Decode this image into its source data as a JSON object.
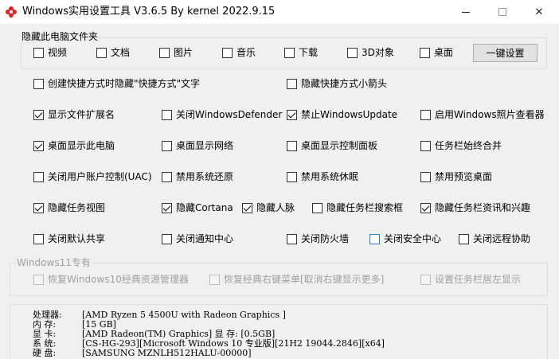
{
  "window": {
    "title": "Windows实用设置工具 V3.6.5 By kernel 2022.9.15",
    "icon": "flower-app-icon",
    "close_glyph": "✕"
  },
  "hide_folders": {
    "label": "隐藏此电脑文件夹",
    "items": [
      "视频",
      "文档",
      "图片",
      "音乐",
      "下载",
      "3D对象",
      "桌面"
    ],
    "button": "一键设置"
  },
  "options": {
    "create_shortcut": "创建快捷方式时隐藏\"快捷方式\"文字",
    "hide_shortcut_arrow": "隐藏快捷方式小箭头",
    "show_ext": "显示文件扩展名",
    "close_defender": "关闭WindowsDefender",
    "disable_update": "禁止WindowsUpdate",
    "enable_photo_viewer": "启用Windows照片查看器",
    "desktop_this_pc": "桌面显示此电脑",
    "desktop_network": "桌面显示网络",
    "desktop_control_panel": "桌面显示控制面板",
    "taskbar_never_combine": "任务栏始终合并",
    "close_uac": "关闭用户账户控制(UAC)",
    "disable_restore": "禁用系统还原",
    "disable_sleep": "禁用系统休眠",
    "disable_preview_desktop": "禁用预览桌面",
    "hide_task_view": "隐藏任务视图",
    "hide_cortana": "隐藏Cortana",
    "hide_people": "隐藏人脉",
    "hide_taskbar_search": "隐藏任务栏搜索框",
    "hide_news": "隐藏任务栏资讯和兴趣",
    "close_default_share": "关闭默认共享",
    "close_notification": "关闭通知中心",
    "close_firewall": "关闭防火墙",
    "close_security_center": "关闭安全中心",
    "close_remote_assist": "关闭远程协助"
  },
  "win11": {
    "label": "Windows11专有",
    "restore_win10_explorer": "恢复Windows10经典资源管理器",
    "restore_context_menu": "恢复经典右键菜单[取消右键显示更多]",
    "taskbar_left": "设置任务栏居左显示"
  },
  "sysinfo": [
    {
      "label": "处理器:",
      "value": "[AMD Ryzen 5 4500U with Radeon Graphics         ]"
    },
    {
      "label": "内  存:",
      "value": "[15 GB]"
    },
    {
      "label": "显  卡:",
      "value": "[AMD Radeon(TM) Graphics]  显 存: [0.5GB]"
    },
    {
      "label": "系  统:",
      "value": "[CS-HG-293][Microsoft Windows 10 专业版][21H2 19044.2846][x64]"
    },
    {
      "label": "硬  盘:",
      "value": "[SAMSUNG MZNLH512HALU-00000]"
    }
  ]
}
